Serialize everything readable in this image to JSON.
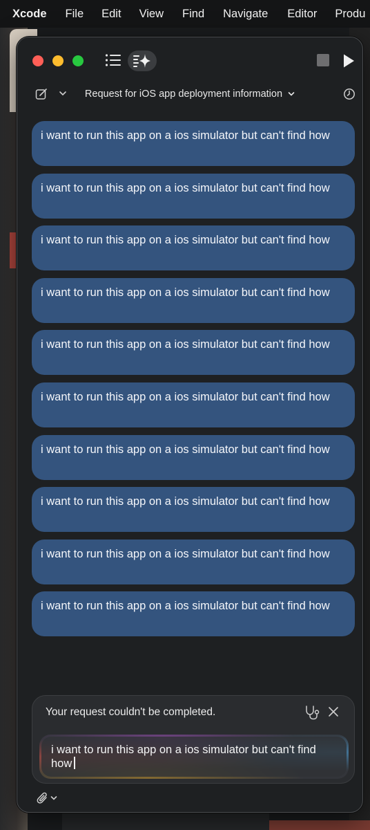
{
  "menubar": {
    "items": [
      "Xcode",
      "File",
      "Edit",
      "View",
      "Find",
      "Navigate",
      "Editor",
      "Produ"
    ]
  },
  "toolbar": {
    "thread_title": "Request for iOS app deployment information",
    "icons": [
      "list-icon",
      "sparkle-icon",
      "stop-icon",
      "play-icon",
      "compose-icon",
      "chevron-down-icon",
      "history-icon"
    ]
  },
  "messages": [
    {
      "text": "i want to run this app on a ios simulator but can't find how"
    },
    {
      "text": "i want to run this app on a ios simulator but can't find how"
    },
    {
      "text": "i want to run this app on a ios simulator but can't find how"
    },
    {
      "text": "i want to run this app on a ios simulator but can't find how"
    },
    {
      "text": "i want to run this app on a ios simulator but can't find how"
    },
    {
      "text": "i want to run this app on a ios simulator but can't find how"
    },
    {
      "text": "i want to run this app on a ios simulator but can't find how"
    },
    {
      "text": "i want to run this app on a ios simulator but can't find how"
    },
    {
      "text": "i want to run this app on a ios simulator but can't find how"
    },
    {
      "text": "i want to run this app on a ios simulator but can't find how"
    }
  ],
  "composer": {
    "error": "Your request couldn't be completed.",
    "input_value": "i want to run this app on a ios simulator but can't find how"
  },
  "colors": {
    "bubble": "#34547e",
    "window_bg": "#1e2022",
    "traffic_red": "#ff5f57",
    "traffic_yellow": "#febc2e",
    "traffic_green": "#28c840"
  }
}
